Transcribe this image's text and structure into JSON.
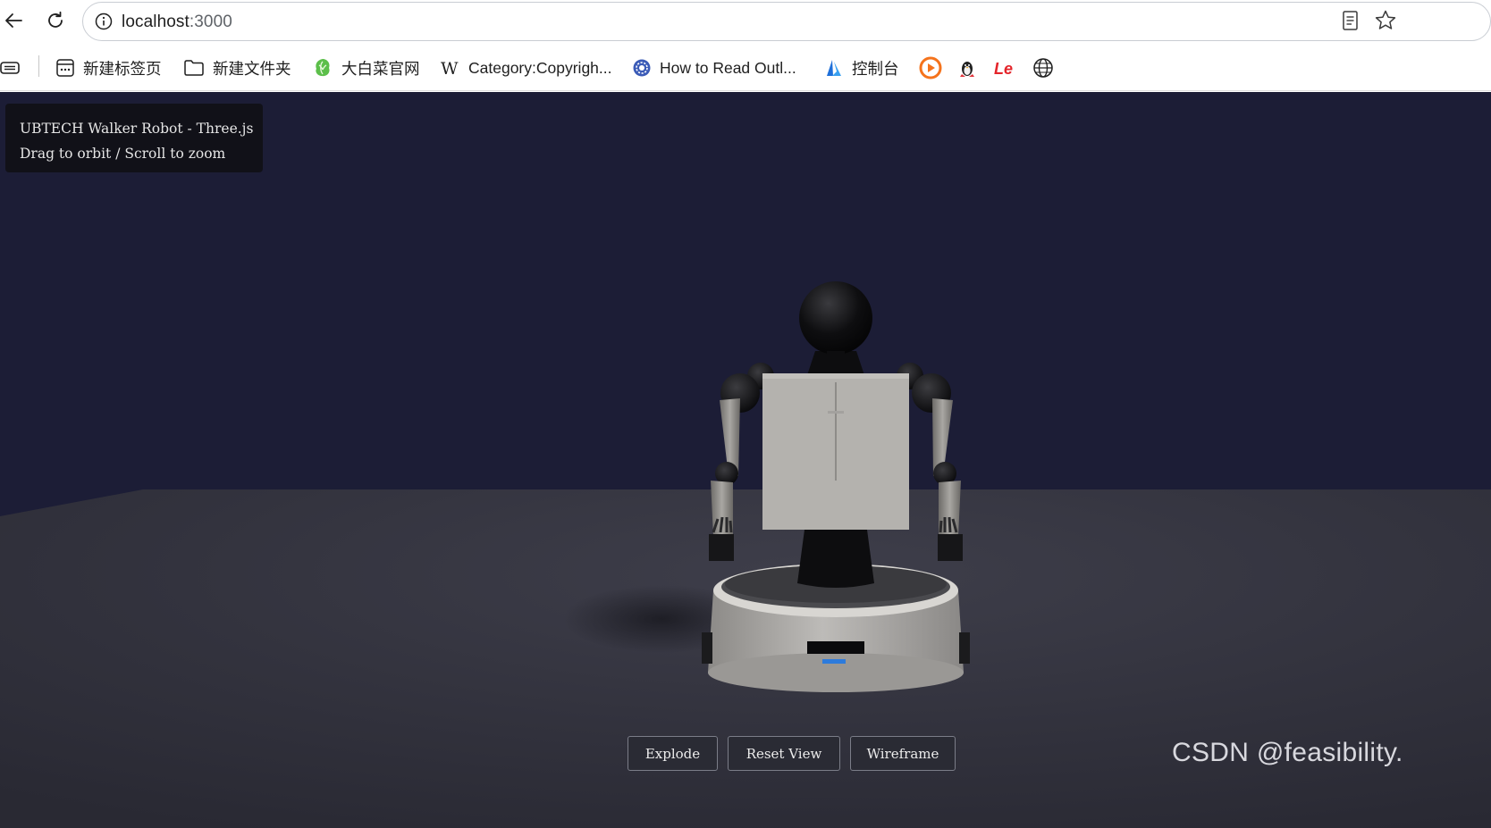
{
  "browser": {
    "url_host": "localhost",
    "url_port": ":3000",
    "bookmarks": [
      {
        "label": "新建标签页",
        "icon": "new-tab-page-icon"
      },
      {
        "label": "新建文件夹",
        "icon": "folder-icon"
      },
      {
        "label": "大白菜官网",
        "icon": "cabbage-icon"
      },
      {
        "label": "Category:Copyrigh...",
        "icon": "wikipedia-icon"
      },
      {
        "label": "How to Read Outl...",
        "icon": "gear-badge-icon"
      },
      {
        "label": "控制台",
        "icon": "azure-icon"
      },
      {
        "label": "",
        "icon": "orange-play-icon"
      },
      {
        "label": "",
        "icon": "penguin-icon"
      },
      {
        "label": "",
        "icon": "le-logo-icon"
      },
      {
        "label": "",
        "icon": "globe-icon"
      }
    ]
  },
  "app": {
    "info_line1": "UBTECH Walker Robot - Three.js",
    "info_line2": "Drag to orbit / Scroll to zoom",
    "buttons": {
      "explode": "Explode",
      "reset_view": "Reset View",
      "wireframe": "Wireframe"
    },
    "watermark": "CSDN @feasibility.",
    "colors": {
      "background": "#1c1d36",
      "floor": "#34343f",
      "panel_white": "#b4b2ae",
      "robot_black": "#0c0c0e"
    }
  }
}
